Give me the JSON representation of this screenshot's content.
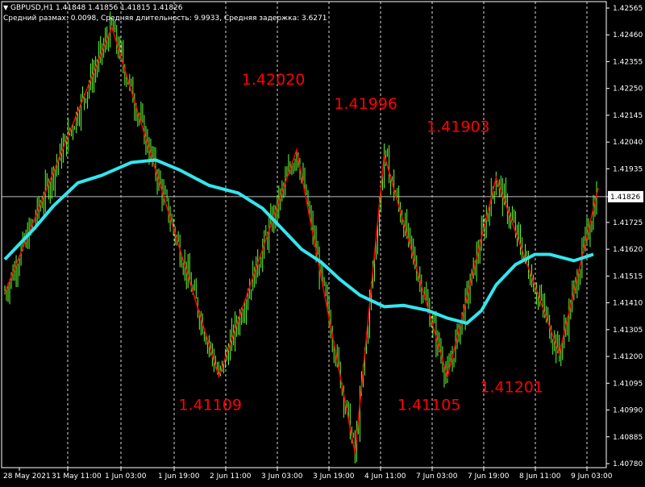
{
  "header": {
    "symbol_line": "GBPUSD,H1  1.41848 1.41856 1.41815 1.41826",
    "stats_line": "Средний размах: 0.0098, Средняя длительность: 9.9933, Средняя задержка: 3.6271"
  },
  "chart_data": {
    "type": "line",
    "symbol": "GBPUSD",
    "timeframe": "H1",
    "ohlc": {
      "open": 1.41848,
      "high": 1.41856,
      "low": 1.41815,
      "close": 1.41826
    },
    "ylim": [
      1.4078,
      1.42565
    ],
    "y_ticks": [
      "1.42565",
      "1.42460",
      "1.42355",
      "1.42250",
      "1.42145",
      "1.42040",
      "1.41935",
      "1.41826",
      "1.41725",
      "1.41620",
      "1.41515",
      "1.41410",
      "1.41305",
      "1.41200",
      "1.41095",
      "1.40990",
      "1.40885",
      "1.40780"
    ],
    "current_price": "1.41826",
    "x_ticks": [
      "28 May 2021",
      "31 May 11:00",
      "1 Jun 03:00",
      "1 Jun 19:00",
      "2 Jun 11:00",
      "3 Jun 03:00",
      "3 Jun 19:00",
      "4 Jun 11:00",
      "7 Jun 03:00",
      "7 Jun 19:00",
      "8 Jun 11:00",
      "9 Jun 03:00"
    ],
    "zigzag": {
      "color": "#ff0000",
      "points": [
        {
          "t": 0,
          "price": 1.4145
        },
        {
          "t": 22,
          "price": 1.4249
        },
        {
          "t": 44,
          "price": 1.4112
        },
        {
          "t": 60,
          "price": 1.4201
        },
        {
          "t": 72,
          "price": 1.4082
        },
        {
          "t": 78,
          "price": 1.4199
        },
        {
          "t": 91,
          "price": 1.4112
        },
        {
          "t": 101,
          "price": 1.419
        },
        {
          "t": 114,
          "price": 1.4121
        },
        {
          "t": 122,
          "price": 1.4186
        }
      ]
    },
    "moving_average": {
      "color": "#33e6ee",
      "points": [
        {
          "t": 0,
          "price": 1.4158
        },
        {
          "t": 6,
          "price": 1.417
        },
        {
          "t": 10,
          "price": 1.4179
        },
        {
          "t": 15,
          "price": 1.4188
        },
        {
          "t": 20,
          "price": 1.4191
        },
        {
          "t": 26,
          "price": 1.4196
        },
        {
          "t": 31,
          "price": 1.4197
        },
        {
          "t": 36,
          "price": 1.4193
        },
        {
          "t": 42,
          "price": 1.4187
        },
        {
          "t": 48,
          "price": 1.4184
        },
        {
          "t": 53,
          "price": 1.4178
        },
        {
          "t": 57,
          "price": 1.417
        },
        {
          "t": 61,
          "price": 1.4162
        },
        {
          "t": 65,
          "price": 1.4157
        },
        {
          "t": 69,
          "price": 1.415
        },
        {
          "t": 73,
          "price": 1.4144
        },
        {
          "t": 78,
          "price": 1.41395
        },
        {
          "t": 82,
          "price": 1.414
        },
        {
          "t": 87,
          "price": 1.4138
        },
        {
          "t": 91,
          "price": 1.4135
        },
        {
          "t": 95,
          "price": 1.4133
        },
        {
          "t": 98,
          "price": 1.4138
        },
        {
          "t": 101,
          "price": 1.4148
        },
        {
          "t": 105,
          "price": 1.4156
        },
        {
          "t": 109,
          "price": 1.416
        },
        {
          "t": 112,
          "price": 1.416
        },
        {
          "t": 117,
          "price": 1.41575
        },
        {
          "t": 121,
          "price": 1.416
        }
      ]
    },
    "swing_labels": [
      {
        "text": "1.42020",
        "t": 55,
        "price": 1.42265
      },
      {
        "text": "1.41996",
        "t": 74,
        "price": 1.4217
      },
      {
        "text": "1.41903",
        "t": 93,
        "price": 1.4208
      },
      {
        "text": "1.41109",
        "t": 42,
        "price": 1.4099
      },
      {
        "text": "1.41105",
        "t": 87,
        "price": 1.4099
      },
      {
        "text": "1.41201",
        "t": 104,
        "price": 1.4106
      }
    ],
    "candle_color": "#66ff33",
    "grid": "vertical-dotted"
  }
}
